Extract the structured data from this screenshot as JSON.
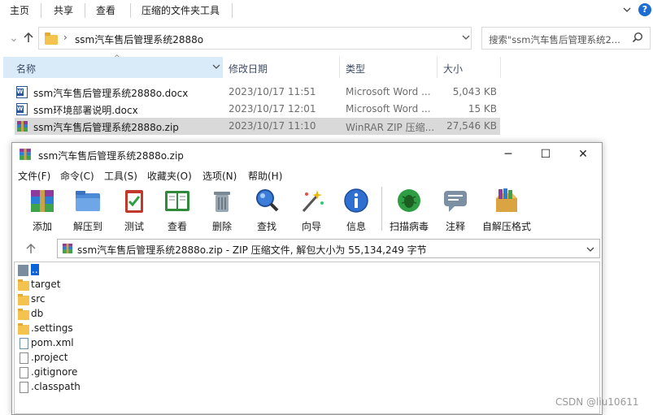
{
  "ribbon": {
    "tabs": [
      "主页",
      "共享",
      "查看"
    ],
    "context_tab": "压缩的文件夹工具",
    "help": "?"
  },
  "address": {
    "path": "ssm汽车售后管理系统2888o",
    "search_placeholder": "搜索\"ssm汽车售后管理系统2...",
    "breadcrumb_chevron": "›"
  },
  "columns": {
    "name": "名称",
    "date": "修改日期",
    "type": "类型",
    "size": "大小"
  },
  "files": [
    {
      "name": "ssm汽车售后管理系统2888o.docx",
      "date": "2023/10/17 11:51",
      "type": "Microsoft Word ...",
      "size": "5,043 KB",
      "icon": "word-icon"
    },
    {
      "name": "ssm环境部署说明.docx",
      "date": "2023/10/17 12:01",
      "type": "Microsoft Word ...",
      "size": "15 KB",
      "icon": "word-icon"
    },
    {
      "name": "ssm汽车售后管理系统2888o.zip",
      "date": "2023/10/17 11:10",
      "type": "WinRAR ZIP 压缩...",
      "size": "27,546 KB",
      "icon": "winrar-icon",
      "selected": true
    }
  ],
  "winrar": {
    "title": "ssm汽车售后管理系统2888o.zip",
    "menu": [
      "文件(F)",
      "命令(C)",
      "工具(S)",
      "收藏夹(O)",
      "选项(N)",
      "帮助(H)"
    ],
    "toolbar": [
      "添加",
      "解压到",
      "测试",
      "查看",
      "删除",
      "查找",
      "向导",
      "信息",
      "扫描病毒",
      "注释",
      "自解压格式"
    ],
    "path_text": "ssm汽车售后管理系统2888o.zip - ZIP 压缩文件, 解包大小为 55,134,249 字节",
    "entries": [
      {
        "name": "..",
        "kind": "up"
      },
      {
        "name": "target",
        "kind": "folder"
      },
      {
        "name": "src",
        "kind": "folder"
      },
      {
        "name": "db",
        "kind": "folder"
      },
      {
        "name": ".settings",
        "kind": "folder"
      },
      {
        "name": "pom.xml",
        "kind": "xml"
      },
      {
        "name": ".project",
        "kind": "file"
      },
      {
        "name": ".gitignore",
        "kind": "file"
      },
      {
        "name": ".classpath",
        "kind": "file"
      }
    ]
  },
  "watermark": "CSDN @liu10611",
  "colors": {
    "accent": "#0a64d8",
    "selection": "#d9d9d9",
    "header_highlight": "#d9ebf9",
    "folder": "#f4c34e"
  }
}
